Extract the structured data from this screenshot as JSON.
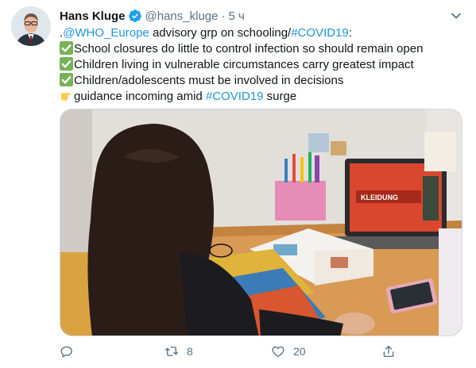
{
  "tweet": {
    "author_name": "Hans Kluge",
    "handle": "@hans_kluge",
    "separator": "·",
    "time": "5 ч",
    "lines": [
      {
        "prefix": ".",
        "mention": "@WHO_Europe",
        "text": " advisory grp on schooling/",
        "hashtag": "#COVID19",
        "suffix": ":"
      },
      {
        "emoji": "check-mark-button-icon",
        "text": "School closures do little to control infection so should remain open"
      },
      {
        "emoji": "check-mark-button-icon",
        "text": "Children living in vulnerable circumstances carry greatest impact"
      },
      {
        "emoji": "check-mark-button-icon",
        "text": "Children/adolescents must be involved in decisions"
      },
      {
        "emoji": "pointing-hand-icon",
        "text": "guidance incoming amid ",
        "hashtag": "#COVID19",
        "suffix": " surge"
      }
    ],
    "actions": {
      "reply_count": "",
      "retweet_count": "8",
      "like_count": "20"
    }
  },
  "colors": {
    "link": "#1b95e0",
    "secondary": "#5b7083",
    "verified": "#1da1f2",
    "check_emoji": "#77b255"
  },
  "icons": [
    "verified-badge-icon",
    "chevron-down-icon",
    "reply-icon",
    "retweet-icon",
    "like-icon",
    "share-icon"
  ]
}
